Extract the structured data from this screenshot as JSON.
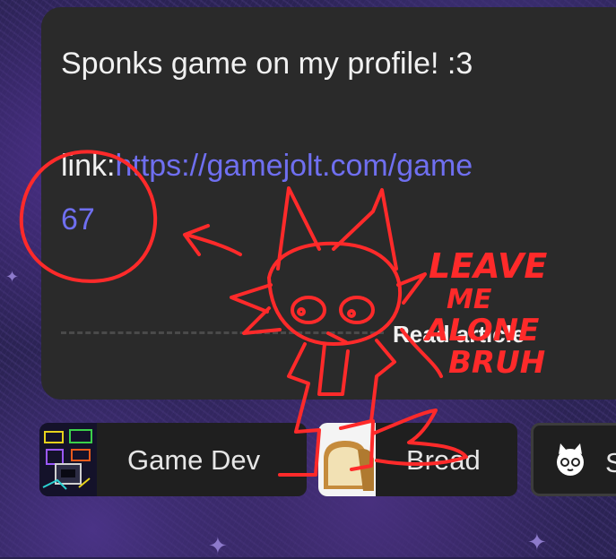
{
  "post": {
    "title": "Sponks game on my profile! :3",
    "link_label": "link:",
    "link_url": "https://gamejolt.com/game",
    "link_url_cont": "67",
    "read_article": "Read article"
  },
  "communities": [
    {
      "label": "Game Dev",
      "icon": "game-dev-thumbnail"
    },
    {
      "label": "Bread",
      "icon": "bread-thumbnail"
    },
    {
      "label": "S",
      "icon": "cat-face-icon"
    }
  ],
  "doodle_text": {
    "line1": "LEAVE",
    "line2": "ME",
    "line3": "ALONE",
    "line4": "BRUH"
  },
  "colors": {
    "card_bg": "#2a2a2a",
    "link": "#6f6ff0",
    "doodle": "#ff2a2a",
    "page_bg": "#2b2354"
  }
}
